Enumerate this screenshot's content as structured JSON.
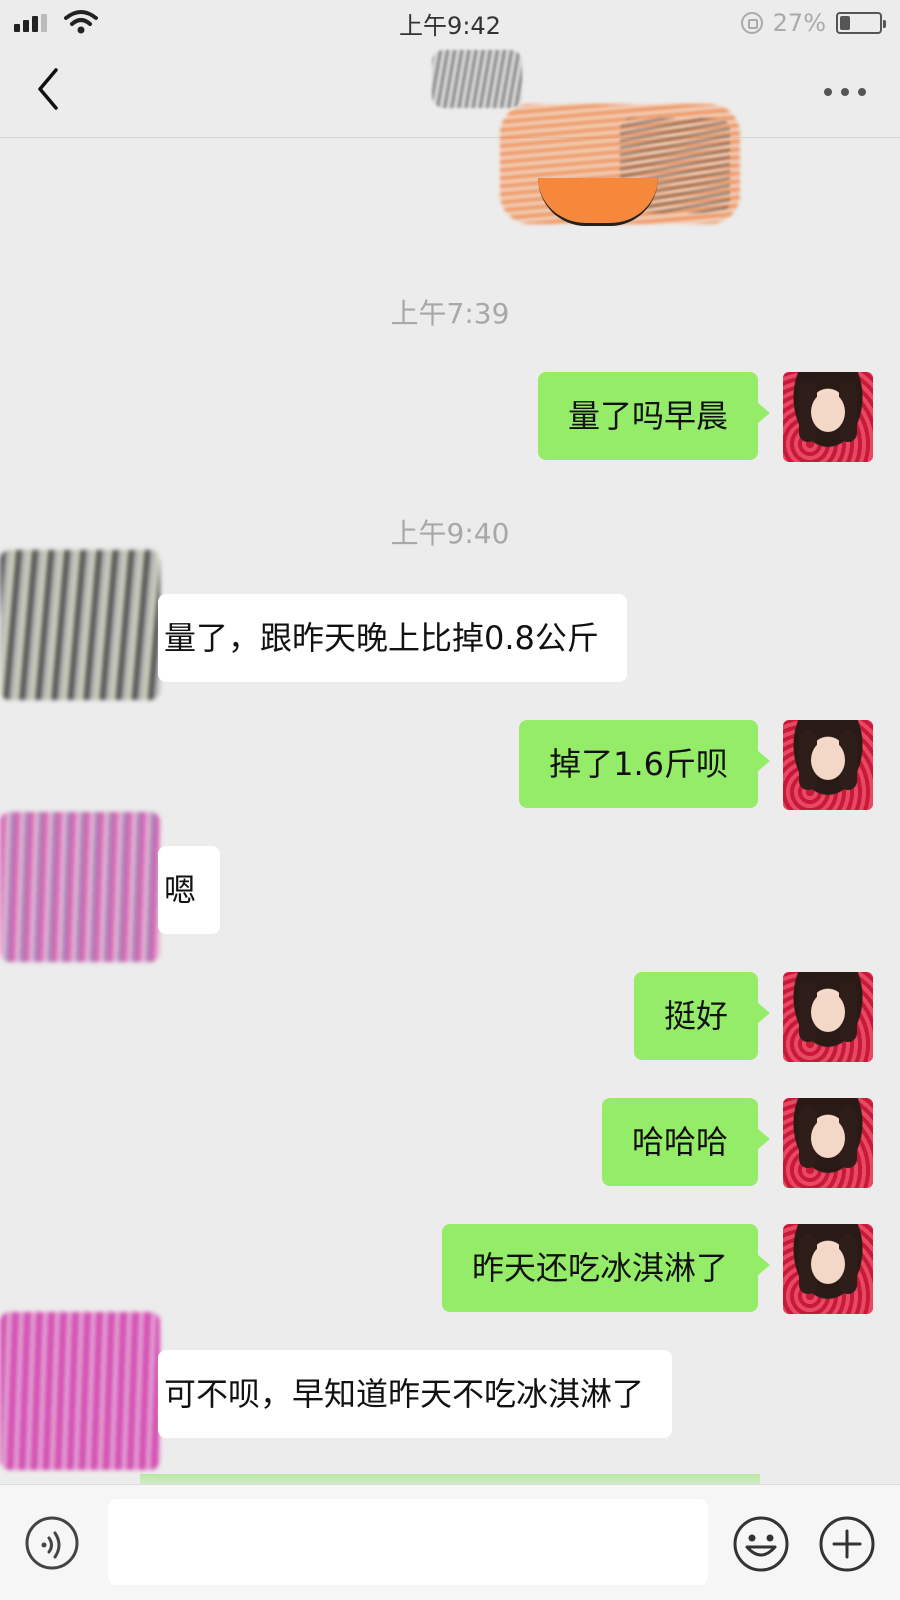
{
  "status_bar": {
    "time": "上午9:42",
    "battery_percent": "27%",
    "battery_level": 0.27,
    "icons": [
      "signal-icon",
      "wifi-icon",
      "rotation-lock-icon",
      "battery-icon"
    ]
  },
  "nav_bar": {
    "icons": [
      "back-arrow-icon",
      "more-dots-icon"
    ]
  },
  "chat": {
    "timestamp_1": "上午7:39",
    "timestamp_2": "上午9:40",
    "messages": [
      {
        "side": "me",
        "text": "量了吗早晨"
      },
      {
        "side": "contact",
        "text": "量了，跟昨天晚上比掉0.8公斤"
      },
      {
        "side": "me",
        "text": "掉了1.6斤呗"
      },
      {
        "side": "contact",
        "text": "嗯"
      },
      {
        "side": "me",
        "text": "挺好"
      },
      {
        "side": "me",
        "text": "哈哈哈"
      },
      {
        "side": "me",
        "text": "昨天还吃冰淇淋了"
      },
      {
        "side": "contact",
        "text": "可不呗，早知道昨天不吃冰淇淋了"
      }
    ]
  },
  "input_bar": {
    "value": "",
    "icons": [
      "voice-icon",
      "emoji-icon",
      "plus-icon"
    ]
  },
  "colors": {
    "background": "#ececec",
    "sent_bubble": "#95ec69",
    "received_bubble": "#ffffff",
    "timestamp": "#a8a8a8"
  }
}
